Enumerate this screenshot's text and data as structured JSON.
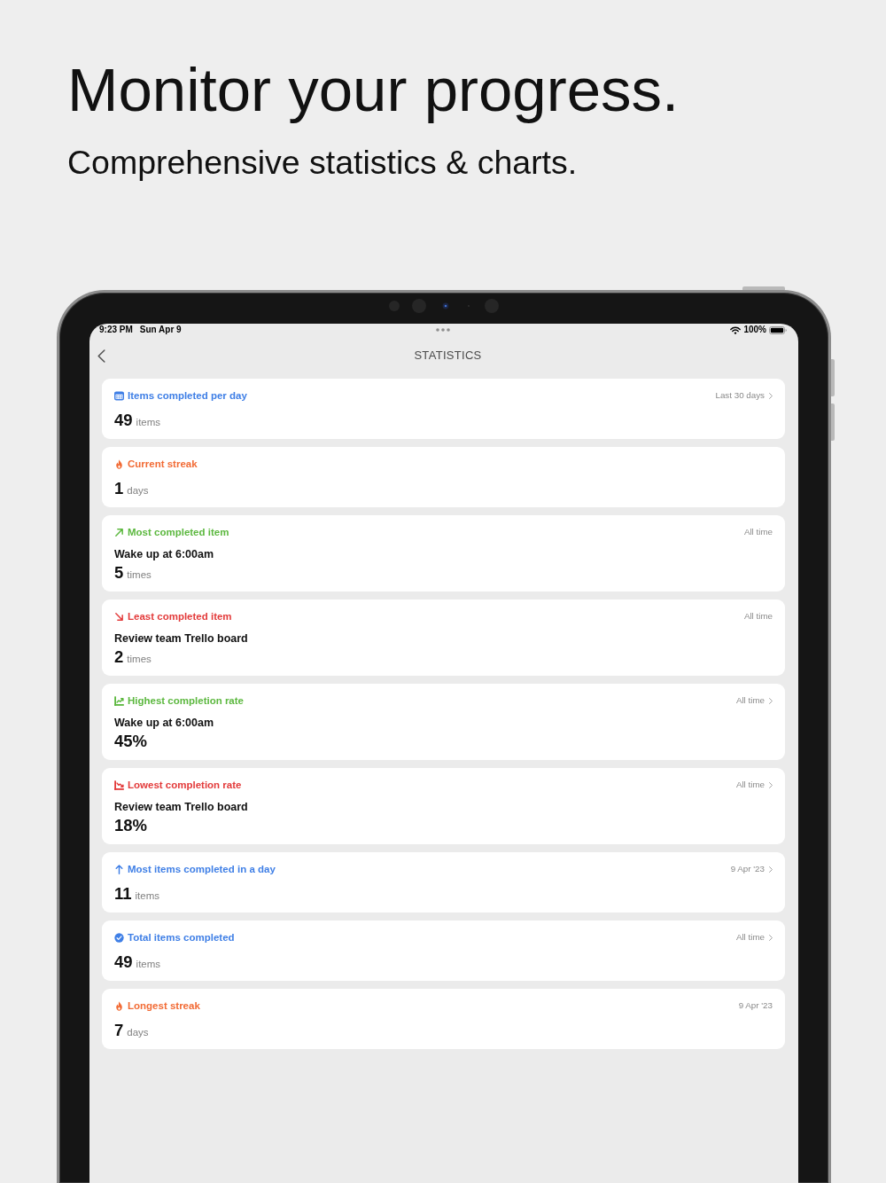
{
  "promo": {
    "headline": "Monitor your progress.",
    "subheadline": "Comprehensive statistics & charts."
  },
  "status_bar": {
    "time": "9:23 PM",
    "date": "Sun Apr 9",
    "battery": "100%"
  },
  "nav": {
    "title": "STATISTICS"
  },
  "cards": [
    {
      "kind": "daily",
      "color": "#3f7fe6",
      "title": "Items completed per day",
      "period": "Last 30 days",
      "disclosure": true,
      "value": "49",
      "unit": "items"
    },
    {
      "kind": "streak",
      "color": "#f26b35",
      "title": "Current streak",
      "disclosure": false,
      "value": "1",
      "unit": "days"
    },
    {
      "kind": "most",
      "color": "#5cb83f",
      "title": "Most completed item",
      "period": "All time",
      "disclosure": false,
      "item": "Wake up at 6:00am",
      "value": "5",
      "unit": "times"
    },
    {
      "kind": "least",
      "color": "#e33b3b",
      "title": "Least completed item",
      "period": "All time",
      "disclosure": false,
      "item": "Review team Trello board",
      "value": "2",
      "unit": "times"
    },
    {
      "kind": "highest",
      "color": "#5cb83f",
      "title": "Highest completion rate",
      "period": "All time",
      "disclosure": true,
      "item": "Wake up at 6:00am",
      "value": "45%"
    },
    {
      "kind": "lowest",
      "color": "#e33b3b",
      "title": "Lowest completion rate",
      "period": "All time",
      "disclosure": true,
      "item": "Review team Trello board",
      "value": "18%"
    },
    {
      "kind": "peak",
      "color": "#3f7fe6",
      "title": "Most items completed in a day",
      "period": "9 Apr '23",
      "disclosure": true,
      "value": "11",
      "unit": "items"
    },
    {
      "kind": "total",
      "color": "#3f7fe6",
      "title": "Total items completed",
      "period": "All time",
      "disclosure": true,
      "value": "49",
      "unit": "items"
    },
    {
      "kind": "streak",
      "color": "#f26b35",
      "title": "Longest streak",
      "period": "9 Apr '23",
      "disclosure": false,
      "value": "7",
      "unit": "days"
    }
  ]
}
